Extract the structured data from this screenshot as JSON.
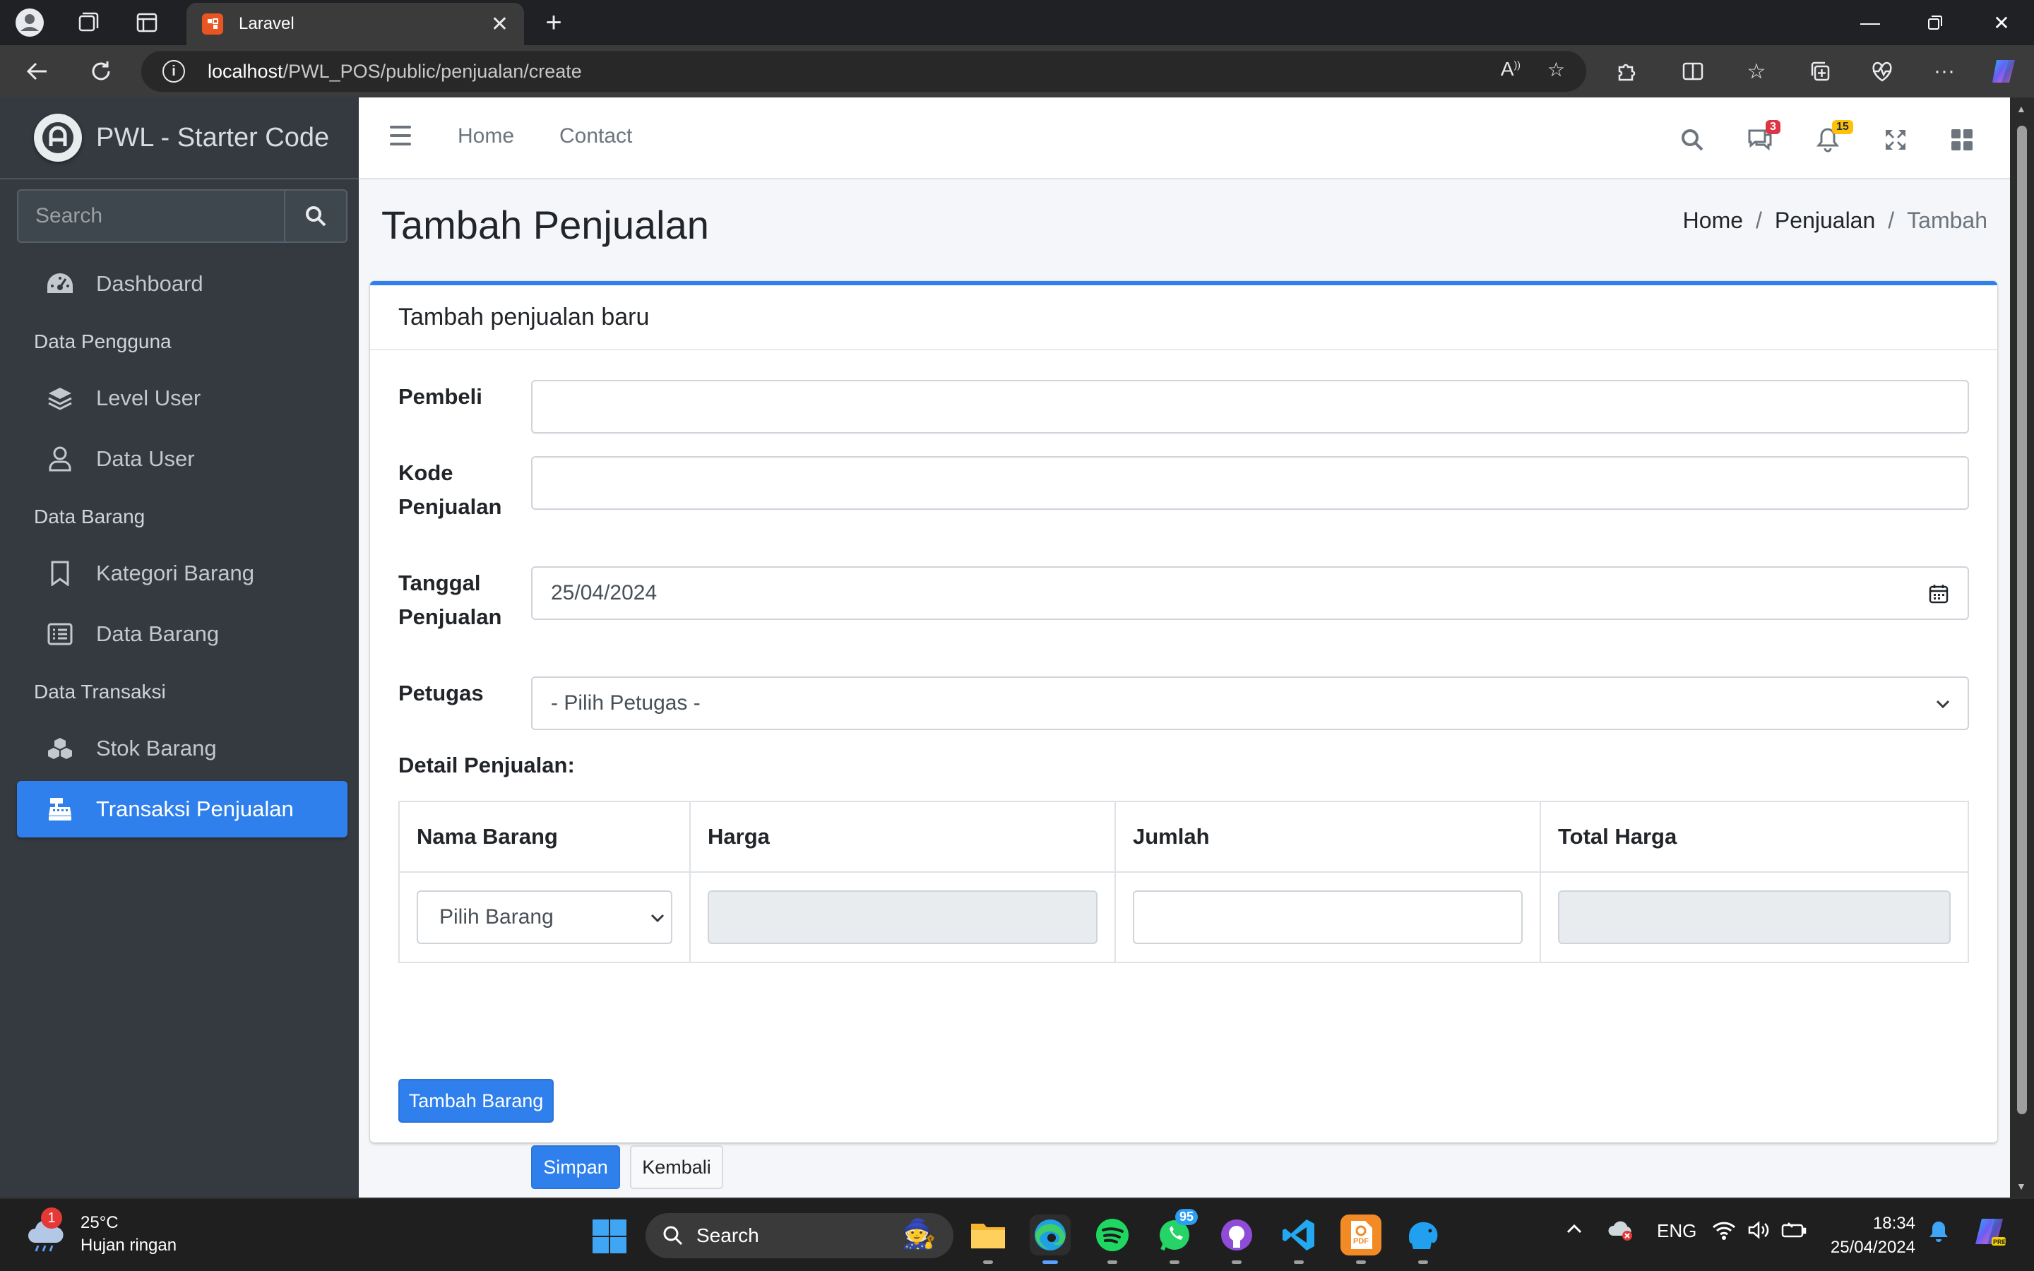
{
  "browser": {
    "tab_title": "Laravel",
    "url_host": "localhost",
    "url_path": "/PWL_POS/public/penjualan/create"
  },
  "sidebar": {
    "brand": "PWL - Starter Code",
    "search_placeholder": "Search",
    "items": [
      {
        "label": "Dashboard",
        "icon": "dashboard-gauge-icon"
      },
      {
        "label": "Level User",
        "icon": "layers-icon"
      },
      {
        "label": "Data User",
        "icon": "user-icon"
      },
      {
        "label": "Kategori Barang",
        "icon": "bookmark-icon"
      },
      {
        "label": "Data Barang",
        "icon": "list-icon"
      },
      {
        "label": "Stok Barang",
        "icon": "cubes-icon"
      },
      {
        "label": "Transaksi Penjualan",
        "icon": "cash-register-icon",
        "active": true
      }
    ],
    "headers": [
      "Data Pengguna",
      "Data Barang",
      "Data Transaksi"
    ]
  },
  "topnav": {
    "links": [
      "Home",
      "Contact"
    ],
    "messages_count": "3",
    "notifications_count": "15"
  },
  "page": {
    "title": "Tambah Penjualan",
    "breadcrumb": [
      "Home",
      "Penjualan",
      "Tambah"
    ]
  },
  "card": {
    "title": "Tambah penjualan baru",
    "fields": {
      "pembeli_label": "Pembeli",
      "pembeli_value": "",
      "kode_label_1": "Kode",
      "kode_label_2": "Penjualan",
      "kode_value": "",
      "tanggal_label_1": "Tanggal",
      "tanggal_label_2": "Penjualan",
      "tanggal_value": "25/04/2024",
      "petugas_label": "Petugas",
      "petugas_value": "- Pilih Petugas -"
    },
    "detail_title": "Detail Penjualan:",
    "table": {
      "headers": [
        "Nama Barang",
        "Harga",
        "Jumlah",
        "Total Harga"
      ],
      "row": {
        "barang": "Pilih Barang",
        "harga": "",
        "jumlah": "",
        "total": ""
      }
    },
    "add_item_button": "Tambah Barang",
    "save_button": "Simpan",
    "back_button": "Kembali"
  },
  "taskbar": {
    "weather_temp": "25°C",
    "weather_desc": "Hujan ringan",
    "weather_badge": "1",
    "search_label": "Search",
    "whatsapp_badge": "95",
    "language": "ENG",
    "time": "18:34",
    "date": "25/04/2024"
  },
  "colors": {
    "primary": "#2f80ed",
    "sidebar_bg": "#343a40",
    "content_bg": "#f4f6f9"
  }
}
